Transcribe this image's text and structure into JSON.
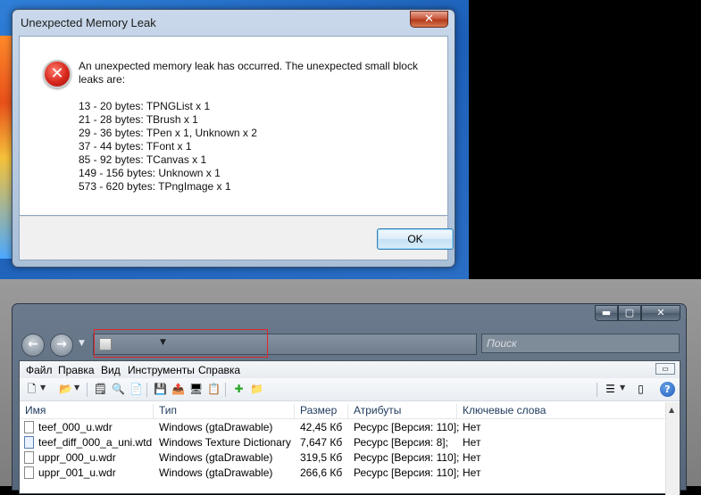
{
  "dialog": {
    "title": "Unexpected Memory Leak",
    "close": "✕",
    "message": "An unexpected memory leak has occurred. The unexpected small block leaks are:",
    "leaks": [
      "13 - 20 bytes: TPNGList x 1",
      "21 - 28 bytes: TBrush x 1",
      "29 - 36 bytes: TPen x 1, Unknown x 2",
      "37 - 44 bytes: TFont x 1",
      "85 - 92 bytes: TCanvas x 1",
      "149 - 156 bytes: Unknown x 1",
      "573 - 620 bytes: TPngImage x 1"
    ],
    "ok_label": "OK"
  },
  "explorer": {
    "window_buttons": {
      "minimize": "▬",
      "maximize": "▢",
      "close": "✕"
    },
    "search_placeholder": "Поиск",
    "menu": [
      "Файл",
      "Правка",
      "Вид",
      "Инструменты",
      "Справка"
    ],
    "columns": [
      "Имя",
      "Тип",
      "Размер",
      "Атрибуты",
      "Ключевые слова"
    ],
    "files": [
      {
        "name": "teef_000_u.wdr",
        "type": "Windows (gtaDrawable)",
        "size": "42,45 Кб",
        "attrs": "Ресурс [Версия: 110];",
        "keywords": "Нет",
        "icon": "file-icon"
      },
      {
        "name": "teef_diff_000_a_uni.wtd",
        "type": "Windows Texture Dictionary",
        "size": "7,647 Кб",
        "attrs": "Ресурс [Версия: 8];",
        "keywords": "Нет",
        "icon": "texture-file-icon"
      },
      {
        "name": "uppr_000_u.wdr",
        "type": "Windows (gtaDrawable)",
        "size": "319,5 Кб",
        "attrs": "Ресурс [Версия: 110];",
        "keywords": "Нет",
        "icon": "file-icon"
      },
      {
        "name": "uppr_001_u.wdr",
        "type": "Windows (gtaDrawable)",
        "size": "266,6 Кб",
        "attrs": "Ресурс [Версия: 110];",
        "keywords": "Нет",
        "icon": "file-icon"
      }
    ]
  },
  "colors": {
    "accent_highlight": "#e0262a",
    "error_red": "#d7271c",
    "desktop_blue": "#1c5fb8"
  }
}
